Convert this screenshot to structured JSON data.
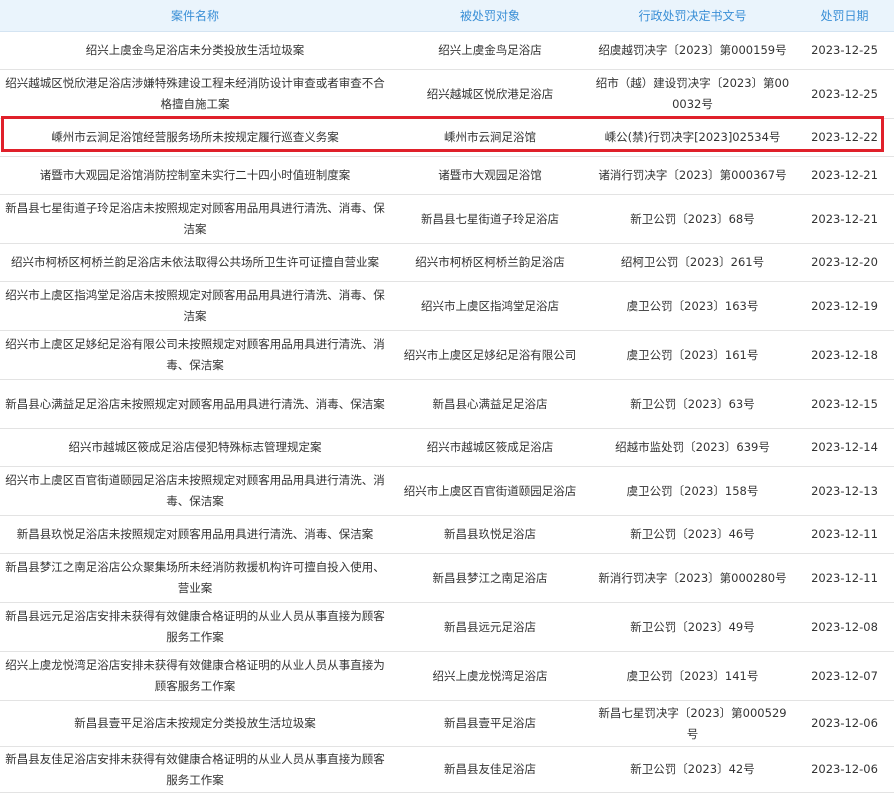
{
  "headers": [
    "案件名称",
    "被处罚对象",
    "行政处罚决定书文号",
    "处罚日期"
  ],
  "rows": [
    {
      "name": "绍兴上虞金鸟足浴店未分类投放生活垃圾案",
      "target": "绍兴上虞金鸟足浴店",
      "doc": "绍虞越罚决字〔2023〕第000159号",
      "date": "2023-12-25"
    },
    {
      "name": "绍兴越城区悦欣港足浴店涉嫌特殊建设工程未经消防设计审查或者审查不合格擅自施工案",
      "target": "绍兴越城区悦欣港足浴店",
      "doc": "绍市（越）建设罚决字〔2023〕第000032号",
      "date": "2023-12-25"
    },
    {
      "name": "嵊州市云涧足浴馆经营服务场所未按规定履行巡查义务案",
      "target": "嵊州市云涧足浴馆",
      "doc": "嵊公(禁)行罚决字[2023]02534号",
      "date": "2023-12-22"
    },
    {
      "name": "诸暨市大观园足浴馆消防控制室未实行二十四小时值班制度案",
      "target": "诸暨市大观园足浴馆",
      "doc": "诸消行罚决字〔2023〕第000367号",
      "date": "2023-12-21"
    },
    {
      "name": "新昌县七星街道子玲足浴店未按照规定对顾客用品用具进行清洗、消毒、保洁案",
      "target": "新昌县七星街道子玲足浴店",
      "doc": "新卫公罚〔2023〕68号",
      "date": "2023-12-21"
    },
    {
      "name": "绍兴市柯桥区柯桥兰韵足浴店未依法取得公共场所卫生许可证擅自营业案",
      "target": "绍兴市柯桥区柯桥兰韵足浴店",
      "doc": "绍柯卫公罚〔2023〕261号",
      "date": "2023-12-20"
    },
    {
      "name": "绍兴市上虞区指鸿堂足浴店未按照规定对顾客用品用具进行清洗、消毒、保洁案",
      "target": "绍兴市上虞区指鸿堂足浴店",
      "doc": "虞卫公罚〔2023〕163号",
      "date": "2023-12-19"
    },
    {
      "name": "绍兴市上虞区足姼纪足浴有限公司未按照规定对顾客用品用具进行清洗、消毒、保洁案",
      "target": "绍兴市上虞区足姼纪足浴有限公司",
      "doc": "虞卫公罚〔2023〕161号",
      "date": "2023-12-18"
    },
    {
      "name": "新昌县心满益足足浴店未按照规定对顾客用品用具进行清洗、消毒、保洁案",
      "target": "新昌县心满益足足浴店",
      "doc": "新卫公罚〔2023〕63号",
      "date": "2023-12-15"
    },
    {
      "name": "绍兴市越城区筱成足浴店侵犯特殊标志管理规定案",
      "target": "绍兴市越城区筱成足浴店",
      "doc": "绍越市监处罚〔2023〕639号",
      "date": "2023-12-14"
    },
    {
      "name": "绍兴市上虞区百官街道颐园足浴店未按照规定对顾客用品用具进行清洗、消毒、保洁案",
      "target": "绍兴市上虞区百官街道颐园足浴店",
      "doc": "虞卫公罚〔2023〕158号",
      "date": "2023-12-13"
    },
    {
      "name": "新昌县玖悦足浴店未按照规定对顾客用品用具进行清洗、消毒、保洁案",
      "target": "新昌县玖悦足浴店",
      "doc": "新卫公罚〔2023〕46号",
      "date": "2023-12-11"
    },
    {
      "name": "新昌县梦江之南足浴店公众聚集场所未经消防救援机构许可擅自投入使用、营业案",
      "target": "新昌县梦江之南足浴店",
      "doc": "新消行罚决字〔2023〕第000280号",
      "date": "2023-12-11"
    },
    {
      "name": "新昌县远元足浴店安排未获得有效健康合格证明的从业人员从事直接为顾客服务工作案",
      "target": "新昌县远元足浴店",
      "doc": "新卫公罚〔2023〕49号",
      "date": "2023-12-08"
    },
    {
      "name": "绍兴上虞龙悦湾足浴店安排未获得有效健康合格证明的从业人员从事直接为顾客服务工作案",
      "target": "绍兴上虞龙悦湾足浴店",
      "doc": "虞卫公罚〔2023〕141号",
      "date": "2023-12-07"
    },
    {
      "name": "新昌县壹平足浴店未按规定分类投放生活垃圾案",
      "target": "新昌县壹平足浴店",
      "doc": "新昌七星罚决字〔2023〕第000529号",
      "date": "2023-12-06"
    },
    {
      "name": "新昌县友佳足浴店安排未获得有效健康合格证明的从业人员从事直接为顾客服务工作案",
      "target": "新昌县友佳足浴店",
      "doc": "新卫公罚〔2023〕42号",
      "date": "2023-12-06"
    }
  ],
  "highlight_color": "#e0202a",
  "header_bg": "#eaf4fc",
  "header_text_color": "#3a8fd6"
}
